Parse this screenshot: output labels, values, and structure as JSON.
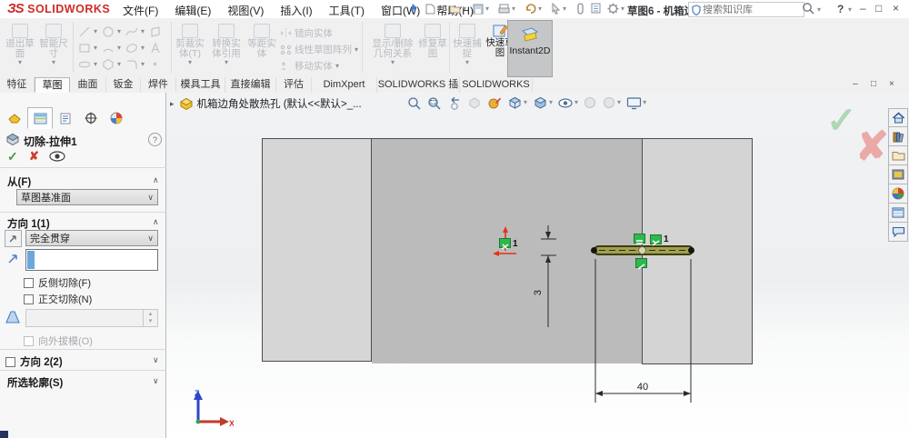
{
  "titlebar": {
    "brand_mark": "ЗS",
    "brand": "SOLIDWORKS",
    "menus": [
      {
        "label": "文件(F)"
      },
      {
        "label": "编辑(E)"
      },
      {
        "label": "视图(V)"
      },
      {
        "label": "插入(I)"
      },
      {
        "label": "工具(T)"
      },
      {
        "label": "窗口(W)"
      },
      {
        "label": "帮助(H)"
      }
    ],
    "doc_short_title": "草图6 - 机箱边...",
    "search": {
      "placeholder": "搜索知识库"
    },
    "help_label": "?"
  },
  "glyphs": {
    "caret_down": "▾",
    "chevron_up": "∧",
    "chevron_down": "∨",
    "check": "✓",
    "cross": "✘",
    "expander": "▸",
    "minimize": "–",
    "restore": "□",
    "close": "×",
    "spin_up": "▴",
    "spin_down": "▾"
  },
  "ribbon": {
    "exit_sketch": {
      "l1": "退出草",
      "l2": "面"
    },
    "smart_dimension": {
      "l1": "智能尺",
      "l2": "寸"
    },
    "trim": {
      "l1": "剪裁实",
      "l2": "体(T)"
    },
    "convert": {
      "l1": "转换实",
      "l2": "体引用"
    },
    "offset": {
      "l1": "等距实",
      "l2": "体"
    },
    "mirror": "镜向实体",
    "linear_pattern": "线性草图阵列",
    "move": "移动实体",
    "relations": {
      "l1": "显示/删除",
      "l2": "几何关系"
    },
    "repair": {
      "l1": "修复草",
      "l2": "图"
    },
    "snaps": {
      "l1": "快速捕",
      "l2": "捉"
    },
    "rapid_sketch": {
      "l1": "快速草",
      "l2": "图"
    },
    "instant2d": "Instant2D"
  },
  "tabs": [
    {
      "label": "特征"
    },
    {
      "label": "草图"
    },
    {
      "label": "曲面"
    },
    {
      "label": "钣金"
    },
    {
      "label": "焊件"
    },
    {
      "label": "模具工具"
    },
    {
      "label": "直接编辑"
    },
    {
      "label": "评估"
    },
    {
      "label": "DimXpert"
    },
    {
      "label": "SOLIDWORKS 插件"
    },
    {
      "label": "SOLIDWORKS MBD"
    }
  ],
  "docbar": {
    "title": "机箱边角处散热孔 (默认<<默认>_..."
  },
  "panel": {
    "title": "切除-拉伸1",
    "from": {
      "label": "从(F)",
      "value": "草图基准面"
    },
    "direction1": {
      "label": "方向 1(1)",
      "value": "完全贯穿",
      "reverse_side": "反侧切除(F)",
      "normal_cut": "正交切除(N)",
      "draft_outward": "向外拔模(O)"
    },
    "direction2": {
      "label": "方向 2(2)"
    },
    "selected_contours": {
      "label": "所选轮廓(S)"
    }
  },
  "viewport": {
    "dim_width": "40",
    "dim_height": "3",
    "origin_constraint_label": "1",
    "slot_constraint_label": "1",
    "triad": {
      "x": "X",
      "z": "Z"
    }
  },
  "colors": {
    "constraint_green": "#2eb84d",
    "origin_red": "#e23318",
    "dimension_line": "#2b2b2b",
    "brand_red": "#cf2b26"
  }
}
